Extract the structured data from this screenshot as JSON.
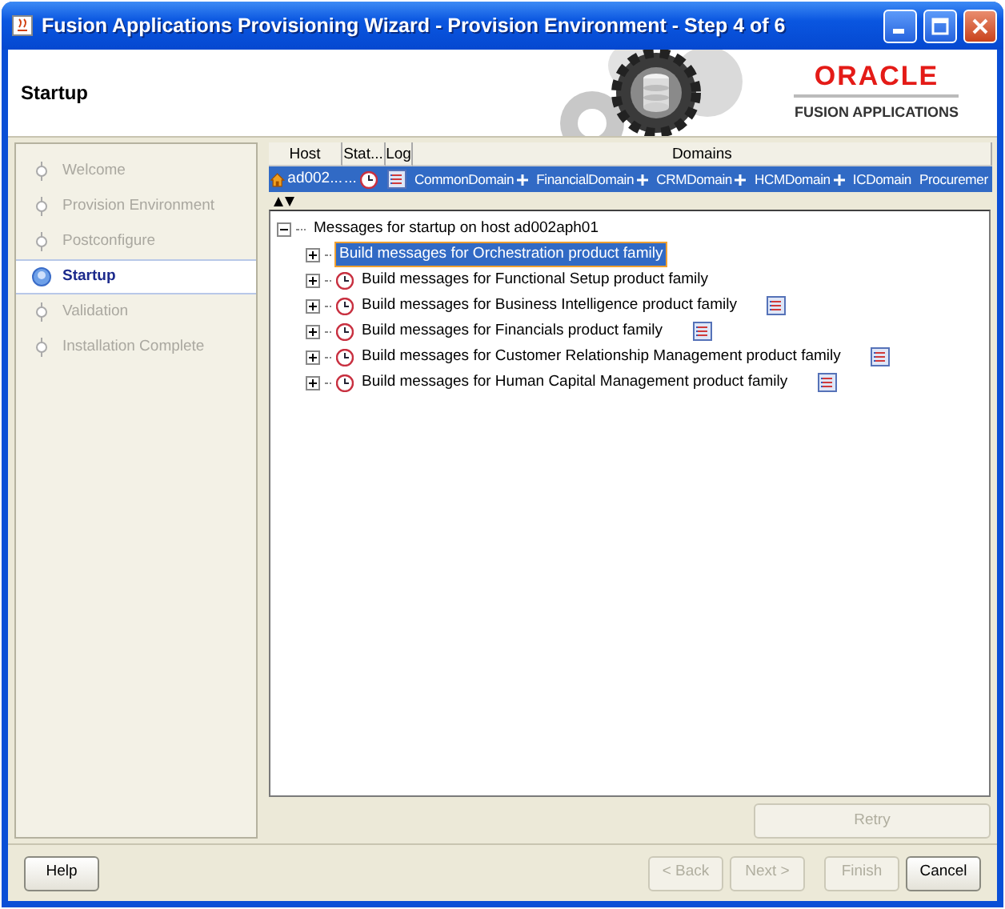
{
  "window": {
    "title": "Fusion Applications Provisioning Wizard - Provision Environment - Step 4 of 6"
  },
  "header": {
    "title": "Startup",
    "logo": {
      "brand": "ORACLE",
      "product": "FUSION APPLICATIONS"
    }
  },
  "steps": [
    {
      "label": "Welcome",
      "selected": false
    },
    {
      "label": "Provision Environment",
      "selected": false
    },
    {
      "label": "Postconfigure",
      "selected": false
    },
    {
      "label": "Startup",
      "selected": true
    },
    {
      "label": "Validation",
      "selected": false
    },
    {
      "label": "Installation Complete",
      "selected": false
    }
  ],
  "table": {
    "columns": [
      "Host",
      "Stat...",
      "Log",
      "Domains"
    ],
    "rows": [
      {
        "selected": true,
        "host": "ad002...",
        "status": "...",
        "domains": [
          {
            "name": "CommonDomain",
            "expandable": true
          },
          {
            "name": "FinancialDomain",
            "expandable": true
          },
          {
            "name": "CRMDomain",
            "expandable": true
          },
          {
            "name": "HCMDomain",
            "expandable": true
          },
          {
            "name": "ICDomain",
            "expandable": false
          },
          {
            "name": "Procuremer",
            "expandable": false
          }
        ]
      }
    ]
  },
  "tree": {
    "label": "Messages for startup on host ad002aph01",
    "expanded": true,
    "children": [
      {
        "label": "Build messages for Orchestration product family",
        "selected": true,
        "expanded": false,
        "pending": false,
        "log": false
      },
      {
        "label": "Build messages for Functional Setup product family",
        "selected": false,
        "expanded": false,
        "pending": true,
        "log": false
      },
      {
        "label": "Build messages for Business Intelligence product family",
        "selected": false,
        "expanded": false,
        "pending": true,
        "log": true
      },
      {
        "label": "Build messages for Financials product family",
        "selected": false,
        "expanded": false,
        "pending": true,
        "log": true
      },
      {
        "label": "Build messages for Customer Relationship Management product family",
        "selected": false,
        "expanded": false,
        "pending": true,
        "log": true
      },
      {
        "label": "Build messages for Human Capital Management product family",
        "selected": false,
        "expanded": false,
        "pending": true,
        "log": true
      }
    ]
  },
  "retry_button": {
    "label": "Retry",
    "disabled": true
  },
  "buttons": [
    {
      "label": "Help",
      "disabled": false,
      "kind": "left"
    },
    {
      "label": "< Back",
      "disabled": true,
      "kind": "right"
    },
    {
      "label": "Next >",
      "disabled": true,
      "kind": "right"
    },
    {
      "label": "Finish",
      "disabled": true,
      "kind": "gap"
    },
    {
      "label": "Cancel",
      "disabled": false,
      "kind": "right"
    }
  ]
}
